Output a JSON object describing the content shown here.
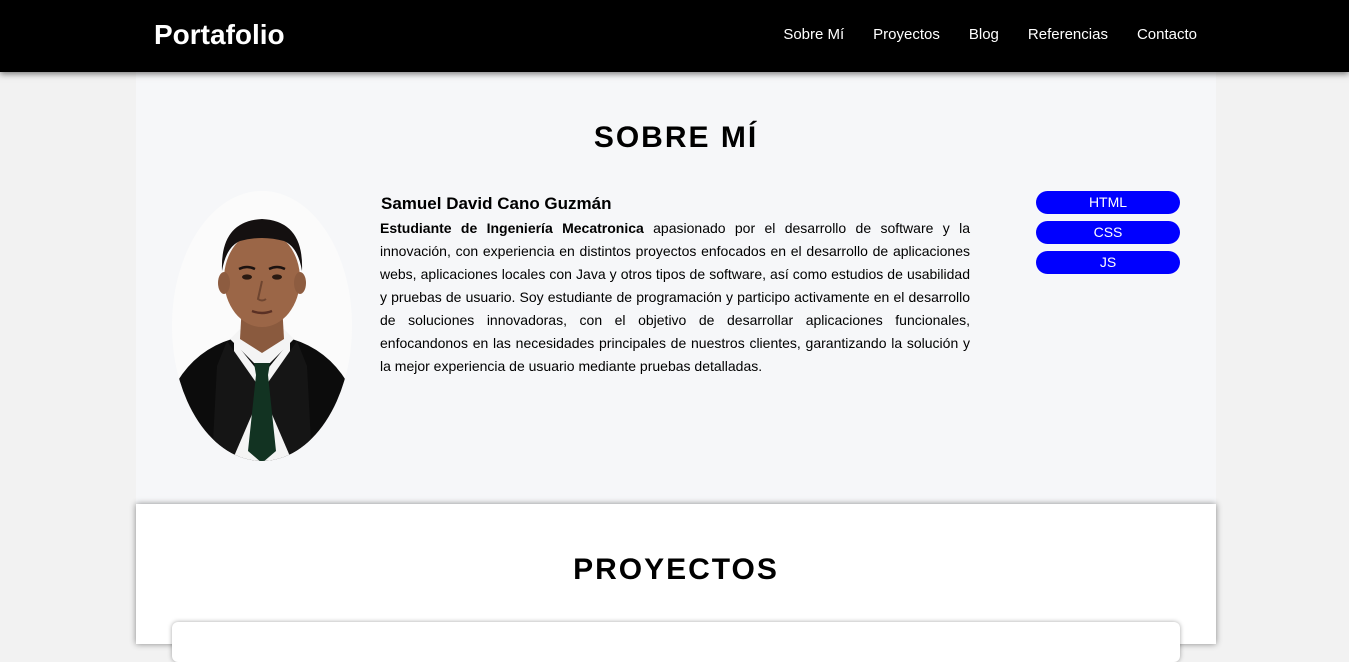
{
  "nav": {
    "brand": "Portafolio",
    "links": [
      "Sobre Mí",
      "Proyectos",
      "Blog",
      "Referencias",
      "Contacto"
    ]
  },
  "about": {
    "title": "SOBRE MÍ",
    "name": "Samuel David Cano Guzmán",
    "bio_bold": "Estudiante de Ingeniería Mecatronica",
    "bio_rest": " apasionado por el desarrollo de software y la innovación, con experiencia en distintos proyectos enfocados en el desarrollo de aplicaciones webs, aplicaciones locales con Java y otros tipos de software, así como estudios de usabilidad y pruebas de usuario. Soy estudiante de programación y participo activamente en el desarrollo de soluciones innovadoras, con el objetivo de desarrollar aplicaciones funcionales, enfocandonos en las necesidades principales de nuestros clientes, garantizando la solución y la mejor experiencia de usuario mediante pruebas detalladas.",
    "skills": [
      "HTML",
      "CSS",
      "JS"
    ]
  },
  "projects": {
    "title": "PROYECTOS"
  },
  "colors": {
    "nav_bg": "#000000",
    "skill_badge": "#0000ff",
    "about_bg": "#f6f7f9"
  }
}
